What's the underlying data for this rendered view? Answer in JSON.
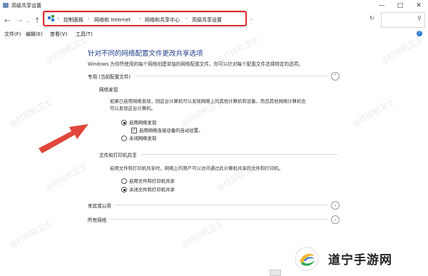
{
  "window": {
    "title": "高级共享设置"
  },
  "address": {
    "breadcrumbs": [
      "控制面板",
      "网络和 Internet",
      "网络和共享中心",
      "高级共享设置"
    ]
  },
  "menu": [
    "文件(F)",
    "编辑(E)",
    "查看(V)",
    "工具(T)"
  ],
  "content": {
    "heading": "针对不同的网络配置文件更改共享选项",
    "description": "Windows 为你所使用的每个网络创建单独的网络配置文件。你可以针对每个配置文件选择特定的选项。",
    "private": {
      "label": "专用 (当前配置文件)",
      "discovery": {
        "title": "网络发现",
        "text_line1": "如果已启用网络发现，则这台计算机可以发现网络上的其他计算机和设备，而且其他网络计算机也",
        "text_line2": "可以发现这台计算机。",
        "opt_on": "启用网络发现",
        "opt_auto": "启用网络连接设备的自动设置。",
        "opt_off": "关闭网络发现",
        "selected": "on",
        "auto_checked": true
      },
      "sharing": {
        "title": "文件和打印机共享",
        "text": "启用文件和打印机共享时，网络上的用户可以访问通过此计算机共享的文件和打印机。",
        "opt_on": "启用文件和打印机共享",
        "opt_off": "关闭文件和打印机共享",
        "selected": "off"
      }
    },
    "guest": {
      "label": "来宾或公用"
    },
    "all": {
      "label": "所有网络"
    }
  },
  "watermark": "@打印机卫士",
  "brand": {
    "name": "道宁手游网"
  },
  "colors": {
    "heading": "#1e3a8a",
    "highlight": "#e02b2b",
    "arrow": "#e0463a"
  },
  "icons": [
    "back-arrow-icon",
    "forward-arrow-icon",
    "up-arrow-icon",
    "control-panel-icon",
    "help-icon",
    "chevron-up-icon",
    "chevron-down-icon"
  ]
}
